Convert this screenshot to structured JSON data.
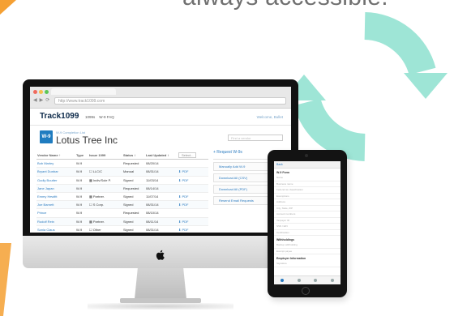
{
  "headline": "always accessible.",
  "colors": {
    "accent": "#2b7bc0",
    "refresh": "#9ee5d6",
    "orange": "#f5a033",
    "w9_badge": "#1f7cc0"
  },
  "browser": {
    "url": "http://www.track1099.com"
  },
  "app": {
    "logo": "Track1099",
    "nav": [
      "1099s",
      "W-9 FAQ"
    ],
    "welcome": "Welcome, Bullet",
    "badge": "W-9",
    "sub_label": "W-9 Completion List",
    "company": "Lotus Tree Inc",
    "search_placeholder": "Find a vendor",
    "table": {
      "headers": [
        "Vendor Name ↑",
        "Type",
        "Issue 1099",
        "Status ↕",
        "Last Updated ↕",
        "Select..."
      ],
      "rows": [
        [
          "Bob Marley",
          "W-9",
          "",
          "Requested",
          "08/20/14",
          ""
        ],
        [
          "Bryant Dunbar",
          "W-9",
          "☐ LLC/C",
          "Manual",
          "08/31/14",
          "⬇ PDF"
        ],
        [
          "Godly Boutter",
          "W-9",
          "▦ Indiv/Sole P.",
          "Signed",
          "11/03/14",
          "⬇ PDF"
        ],
        [
          "Jane Japan",
          "W-9",
          "",
          "Requested",
          "08/14/14",
          ""
        ],
        [
          "Emmy Hewlitt",
          "W-9",
          "▦ Partner.",
          "Signed",
          "11/07/14",
          "⬇ PDF"
        ],
        [
          "Joe Barnett",
          "W-9",
          "☐ S Corp.",
          "Signed",
          "08/31/14",
          "⬇ PDF"
        ],
        [
          "Prince",
          "W-9",
          "",
          "Requested",
          "08/10/14",
          ""
        ],
        [
          "Rudolf Rein",
          "W-9",
          "▦ Partner.",
          "Signed",
          "08/11/14",
          "⬇ PDF"
        ],
        [
          "Sonia Claus",
          "W-9",
          "☐ Other",
          "Signed",
          "08/31/14",
          "⬇ PDF"
        ]
      ]
    },
    "panel": {
      "request_label": "+ Request W-9s",
      "buttons": [
        "Manually Add W-9",
        "Download All (CSV)",
        "Download All (PDF)",
        "Resend Email Requests"
      ]
    }
  },
  "ipad": {
    "top": "Back",
    "sections": [
      {
        "title": "W-9 Form",
        "lines": [
          "Name",
          "Business name",
          "Federal tax classification",
          "Exemptions",
          "Address",
          "City, State, ZIP",
          "Account numbers",
          "Taxpayer ID",
          "SSN / EIN",
          "Certification"
        ]
      },
      {
        "title": "Withholdings",
        "lines": [
          "Backup withholding",
          "Exempt payee"
        ]
      },
      {
        "title": "Employer Information",
        "lines": [
          "Signature"
        ]
      }
    ],
    "tabs": 4
  }
}
